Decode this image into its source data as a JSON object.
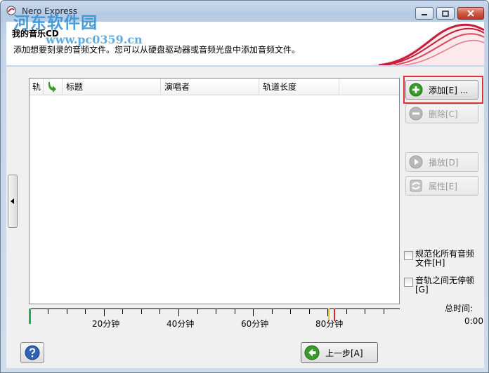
{
  "window": {
    "title": "Nero Express",
    "header_title": "我的音乐CD",
    "header_subtitle": "添加想要刻录的音频文件。您可以从硬盘驱动器或音频光盘中添加音频文件。"
  },
  "watermark": {
    "text": "河东软件园",
    "url": "www.pc0359.cn"
  },
  "list": {
    "columns": [
      "轨",
      "",
      "标题",
      "演唱者",
      "轨道长度"
    ]
  },
  "timeline": {
    "labels": [
      "20分钟",
      "40分钟",
      "60分钟",
      "80分钟"
    ]
  },
  "actions": {
    "add": "添加[E] ...",
    "delete": "删除[C]",
    "play": "播放[D]",
    "properties": "属性[E]"
  },
  "options": {
    "normalize_line1": "规范化所有音频",
    "normalize_line2": "文件[H]",
    "nogap_line1": "音轨之间无停顿",
    "nogap_line2": "[G]"
  },
  "total": {
    "label": "总时间:",
    "value": "0:00"
  },
  "footer": {
    "back": "上一步[A]"
  },
  "colors": {
    "accent_red": "#c41e3a",
    "highlight_red": "#e03232",
    "add_green": "#3a9a2a"
  }
}
